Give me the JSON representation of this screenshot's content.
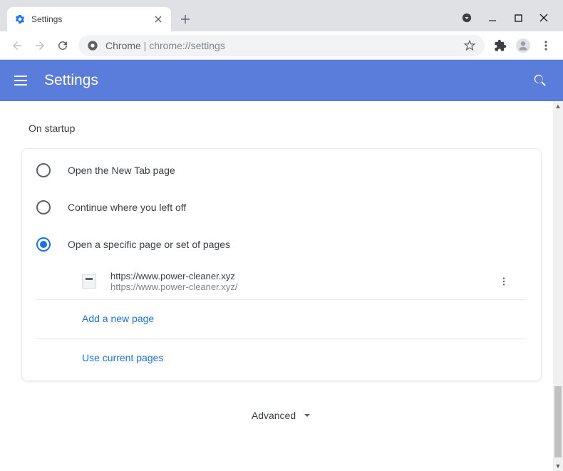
{
  "tab": {
    "title": "Settings"
  },
  "omnibox": {
    "prefix": "Chrome",
    "separator": " | ",
    "path": "chrome://settings"
  },
  "header": {
    "title": "Settings"
  },
  "section": {
    "title": "On startup"
  },
  "options": {
    "opt1": "Open the New Tab page",
    "opt2": "Continue where you left off",
    "opt3": "Open a specific page or set of pages"
  },
  "startup_page": {
    "title": "https://www.power-cleaner.xyz",
    "url": "https://www.power-cleaner.xyz/"
  },
  "links": {
    "add_page": "Add a new page",
    "use_current": "Use current pages"
  },
  "advanced": {
    "label": "Advanced"
  }
}
